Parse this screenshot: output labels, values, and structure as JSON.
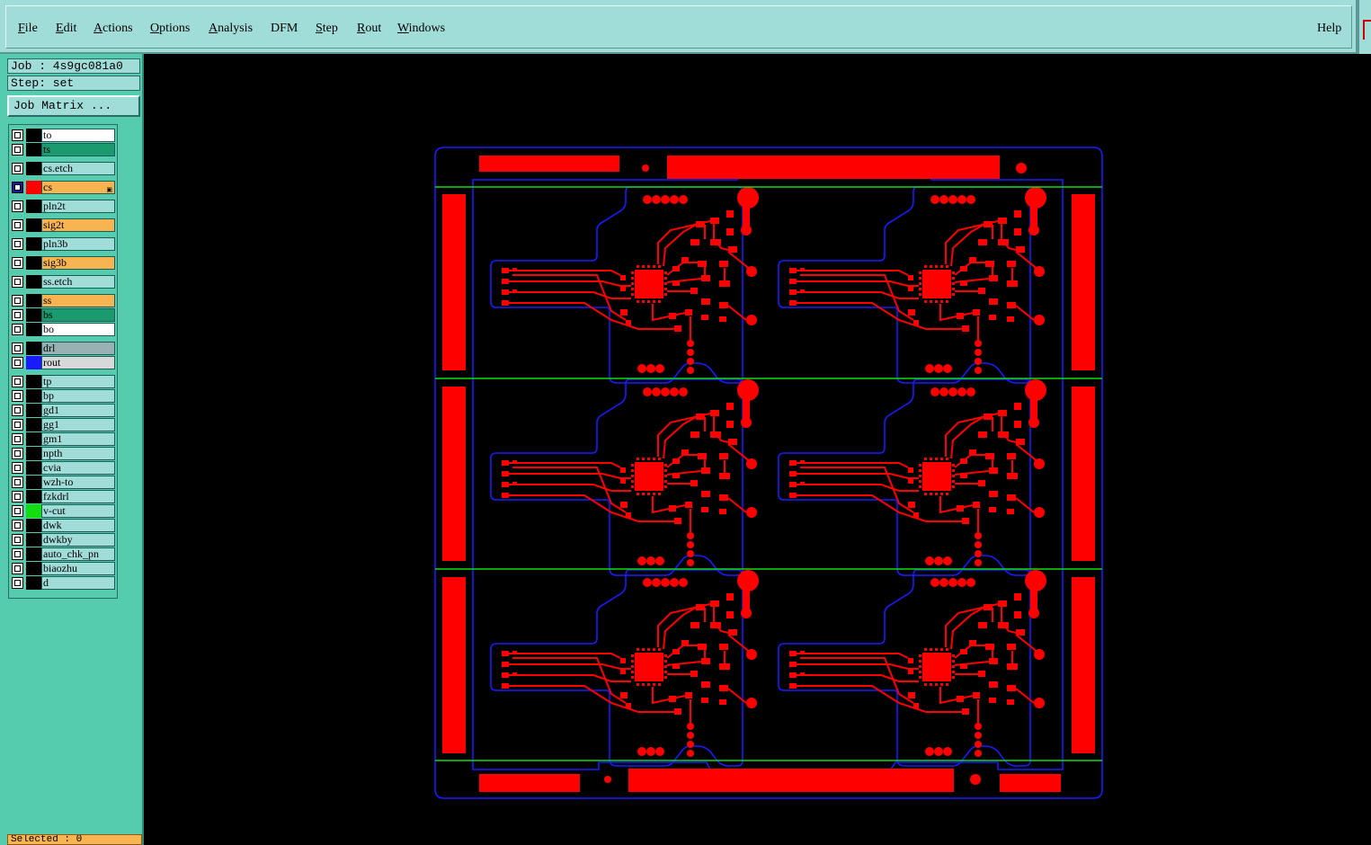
{
  "menubar": {
    "items": [
      {
        "label": "File",
        "mnemonic": "F",
        "rest": "ile"
      },
      {
        "label": "Edit",
        "mnemonic": "E",
        "rest": "dit"
      },
      {
        "label": "Actions",
        "mnemonic": "A",
        "rest": "ctions"
      },
      {
        "label": "Options",
        "mnemonic": "O",
        "rest": "ptions"
      },
      {
        "label": "Analysis",
        "mnemonic": "A",
        "rest": "nalysis"
      },
      {
        "label": "DFM",
        "mnemonic": "",
        "rest": "DFM"
      },
      {
        "label": "Step",
        "mnemonic": "S",
        "rest": "tep"
      },
      {
        "label": "Rout",
        "mnemonic": "R",
        "rest": "out"
      },
      {
        "label": "Windows",
        "mnemonic": "W",
        "rest": "indows"
      }
    ],
    "help": "Help"
  },
  "panel": {
    "job": "Job : 4s9gc081a0",
    "step": "Step: set",
    "job_matrix": "Job Matrix ...",
    "selected": "Selected : 0"
  },
  "layers": [
    {
      "name": "to",
      "bg": "#ffffff"
    },
    {
      "name": "ts",
      "bg": "#1a9a6e"
    },
    {
      "name": "cs.etch",
      "bg": "#a0dcd8"
    },
    {
      "name": "cs",
      "bg": "#f8b450",
      "active": true,
      "swatch": "#ff0000"
    },
    {
      "name": "pln2t",
      "bg": "#a0dcd8"
    },
    {
      "name": "sig2t",
      "bg": "#f8b450"
    },
    {
      "name": "pln3b",
      "bg": "#a0dcd8"
    },
    {
      "name": "sig3b",
      "bg": "#f8b450"
    },
    {
      "name": "ss.etch",
      "bg": "#a0dcd8"
    },
    {
      "name": "ss",
      "bg": "#f8b450"
    },
    {
      "name": "bs",
      "bg": "#1a9a6e"
    },
    {
      "name": "bo",
      "bg": "#ffffff"
    },
    {
      "name": "drl",
      "bg": "#98b2b4"
    },
    {
      "name": "rout",
      "bg": "#d8d8d8",
      "swatch": "#1a1aff"
    },
    {
      "name": "tp",
      "bg": "#a0dcd8"
    },
    {
      "name": "bp",
      "bg": "#a0dcd8"
    },
    {
      "name": "gd1",
      "bg": "#a0dcd8"
    },
    {
      "name": "gg1",
      "bg": "#a0dcd8"
    },
    {
      "name": "gm1",
      "bg": "#a0dcd8"
    },
    {
      "name": "npth",
      "bg": "#a0dcd8"
    },
    {
      "name": "cvia",
      "bg": "#a0dcd8"
    },
    {
      "name": "wzh-to",
      "bg": "#a0dcd8"
    },
    {
      "name": "fzkdrl",
      "bg": "#a0dcd8"
    },
    {
      "name": "v-cut",
      "bg": "#a0dcd8",
      "swatch": "#11dd11"
    },
    {
      "name": "dwk",
      "bg": "#a0dcd8"
    },
    {
      "name": "dwkby",
      "bg": "#a0dcd8"
    },
    {
      "name": "auto_chk_pn",
      "bg": "#a0dcd8"
    },
    {
      "name": "biaozhu",
      "bg": "#a0dcd8"
    },
    {
      "name": "d",
      "bg": "#a0dcd8"
    }
  ],
  "colors": {
    "copper": "#ff0000",
    "rout": "#1a1aff",
    "vcut": "#11dd11",
    "background": "#000000"
  },
  "board": {
    "rows": 3,
    "cols": 2,
    "icons": [
      "pcb-panel-view"
    ]
  }
}
